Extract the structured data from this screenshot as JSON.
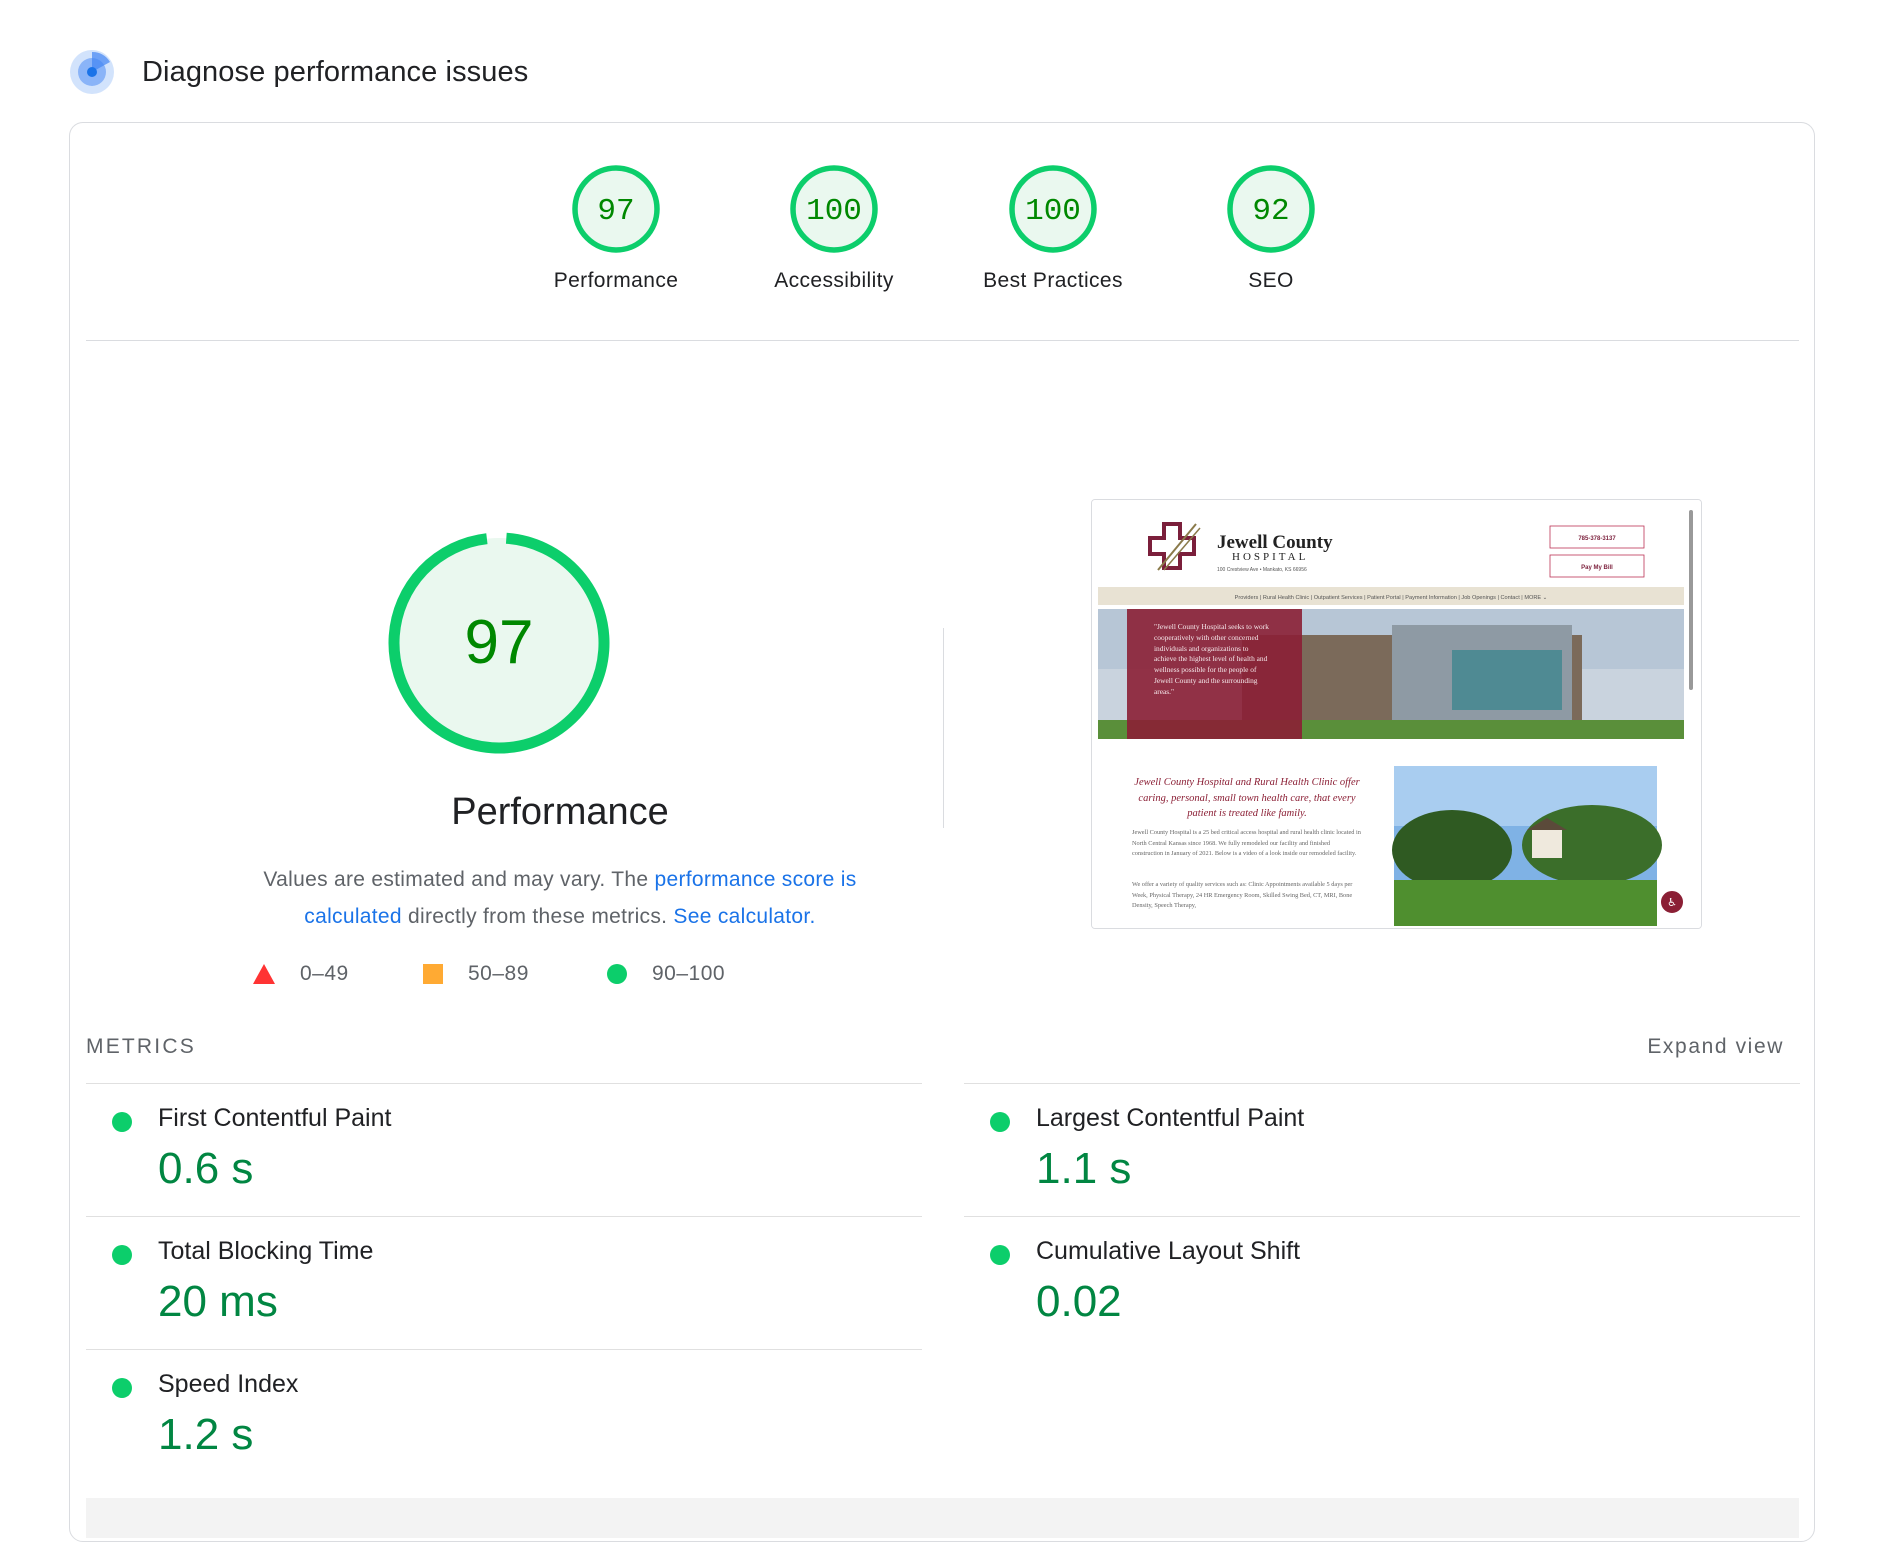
{
  "header": {
    "title": "Diagnose performance issues",
    "icon": "lighthouse-icon"
  },
  "categories": [
    {
      "score": "97",
      "label": "Performance"
    },
    {
      "score": "100",
      "label": "Accessibility"
    },
    {
      "score": "100",
      "label": "Best Practices"
    },
    {
      "score": "92",
      "label": "SEO"
    }
  ],
  "performance": {
    "score": "97",
    "title": "Performance",
    "desc_prefix": "Values are estimated and may vary. The ",
    "desc_link1": "performance score is calculated",
    "desc_middle": " directly from these metrics. ",
    "desc_link2": "See calculator."
  },
  "legend": [
    {
      "range": "0–49",
      "icon": "fail-triangle-icon",
      "color": "#ff3333"
    },
    {
      "range": "50–89",
      "icon": "average-square-icon",
      "color": "#ffaa33"
    },
    {
      "range": "90–100",
      "icon": "pass-circle-icon",
      "color": "#0cce6b"
    }
  ],
  "screenshot": {
    "site_name": "Jewell County",
    "site_sub": "HOSPITAL",
    "address": "100 Crestview Ave • Mankato, KS 66956",
    "phone_button": "785-378-3137",
    "pay_button": "Pay My Bill",
    "nav": "Providers | Rural Health Clinic | Outpatient Services | Patient Portal | Payment Information | Job Openings | Contact | MORE ⌄",
    "hero_quote": "\"Jewell County Hospital seeks to work cooperatively with other concerned individuals and organizations to achieve the highest level of health and wellness possible for the people of Jewell County and the surrounding areas.\"",
    "tagline": "Jewell County Hospital and Rural Health Clinic offer caring, personal, small town health care, that every patient is treated like family.",
    "body1": "Jewell County Hospital is a 25 bed critical access hospital and rural health clinic located in North Central Kansas since 1968. We fully remodeled our facility and finished construction in January of 2021. Below is a video of a look inside our remodeled facility.",
    "body2": "We offer a variety of quality services such as: Clinic Appointments available 5 days per Week, Physical Therapy, 24 HR Emergency Room, Skilled Swing Bed, CT, MRI, Bone Density, Speech Therapy,"
  },
  "metrics": {
    "heading": "METRICS",
    "expand_label": "Expand view",
    "items": [
      {
        "name": "First Contentful Paint",
        "value": "0.6 s"
      },
      {
        "name": "Largest Contentful Paint",
        "value": "1.1 s"
      },
      {
        "name": "Total Blocking Time",
        "value": "20 ms"
      },
      {
        "name": "Cumulative Layout Shift",
        "value": "0.02"
      },
      {
        "name": "Speed Index",
        "value": "1.2 s"
      }
    ]
  },
  "colors": {
    "pass": "#0cce6b",
    "pass_text": "#008800",
    "pass_bg": "#e9f7ee",
    "link": "#1a73e8"
  }
}
